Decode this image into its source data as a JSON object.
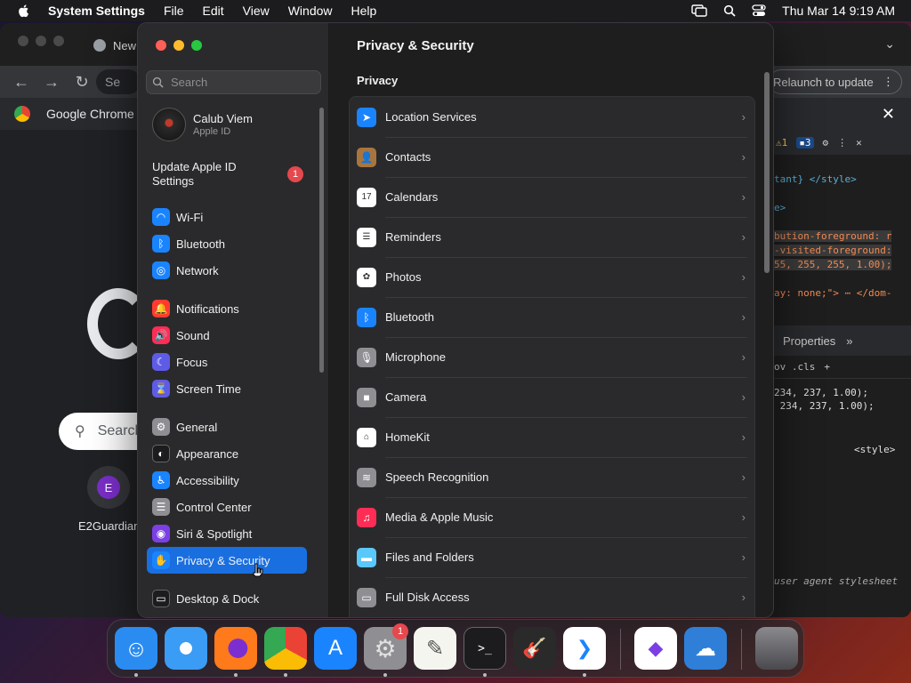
{
  "menubar": {
    "app": "System Settings",
    "items": [
      "File",
      "Edit",
      "View",
      "Window",
      "Help"
    ],
    "datetime": "Thu Mar 14  9:19 AM"
  },
  "chrome": {
    "tab_title": "New",
    "omnibox_text": "Se",
    "relaunch_label": "Relaunch to update",
    "infobar_text": "Google Chrome i",
    "search_placeholder": "Search",
    "shortcut_letter": "E",
    "shortcut_label": "E2Guardian"
  },
  "devtools": {
    "warn_count": "1",
    "info_count": "3",
    "code_lines": [
      "tant} </style>",
      "",
      "e>",
      "",
      "bution-foreground: r",
      "-visited-foreground:",
      "55, 255, 255, 1.00);",
      "",
      "ay: none;\"> ⋯ </dom-"
    ],
    "props_tab": "Properties",
    "styles_toolbar": "ov  .cls",
    "style_lines": [
      "234, 237, 1.00);",
      " 234, 237, 1.00);"
    ],
    "style_tag": "<style>",
    "ua_label": "user agent stylesheet"
  },
  "settings": {
    "search_placeholder": "Search",
    "user": {
      "name": "Calub Viem",
      "subtitle": "Apple ID"
    },
    "update": {
      "label": "Update Apple ID Settings",
      "badge": "1"
    },
    "sidebar": [
      {
        "label": "Wi-Fi",
        "icon": "wifi-icon",
        "color": "#1a84ff",
        "glyph": "◠"
      },
      {
        "label": "Bluetooth",
        "icon": "bluetooth-icon",
        "color": "#1a84ff",
        "glyph": "ᛒ"
      },
      {
        "label": "Network",
        "icon": "globe-icon",
        "color": "#1a84ff",
        "glyph": "◎"
      },
      {
        "label": "Notifications",
        "icon": "bell-icon",
        "color": "#ff3b30",
        "glyph": "🔔"
      },
      {
        "label": "Sound",
        "icon": "speaker-icon",
        "color": "#ff2d55",
        "glyph": "🔊"
      },
      {
        "label": "Focus",
        "icon": "moon-icon",
        "color": "#5e5ce6",
        "glyph": "☾"
      },
      {
        "label": "Screen Time",
        "icon": "hourglass-icon",
        "color": "#5e5ce6",
        "glyph": "⌛"
      },
      {
        "label": "General",
        "icon": "gear-icon",
        "color": "#8e8e93",
        "glyph": "⚙"
      },
      {
        "label": "Appearance",
        "icon": "appearance-icon",
        "color": "#1c1c1e",
        "glyph": "◐"
      },
      {
        "label": "Accessibility",
        "icon": "accessibility-icon",
        "color": "#1a84ff",
        "glyph": "♿"
      },
      {
        "label": "Control Center",
        "icon": "control-center-icon",
        "color": "#8e8e93",
        "glyph": "☰"
      },
      {
        "label": "Siri & Spotlight",
        "icon": "siri-icon",
        "color": "#7b3fe4",
        "glyph": "◉"
      },
      {
        "label": "Privacy & Security",
        "icon": "hand-icon",
        "color": "#1a84ff",
        "glyph": "✋",
        "active": true
      },
      {
        "label": "Desktop & Dock",
        "icon": "dock-icon",
        "color": "#1c1c1e",
        "glyph": "▭"
      }
    ],
    "main": {
      "title": "Privacy & Security",
      "section": "Privacy",
      "rows": [
        {
          "label": "Location Services",
          "icon": "location-arrow-icon",
          "color": "#1a84ff",
          "glyph": "➤"
        },
        {
          "label": "Contacts",
          "icon": "contacts-icon",
          "color": "#a8753f",
          "glyph": "👤"
        },
        {
          "label": "Calendars",
          "icon": "calendar-icon",
          "color": "#ffffff",
          "glyph": "17"
        },
        {
          "label": "Reminders",
          "icon": "reminders-icon",
          "color": "#ffffff",
          "glyph": "☰"
        },
        {
          "label": "Photos",
          "icon": "photos-icon",
          "color": "#ffffff",
          "glyph": "✿"
        },
        {
          "label": "Bluetooth",
          "icon": "bluetooth-icon",
          "color": "#1a84ff",
          "glyph": "ᛒ"
        },
        {
          "label": "Microphone",
          "icon": "microphone-icon",
          "color": "#8e8e93",
          "glyph": "🎙"
        },
        {
          "label": "Camera",
          "icon": "camera-icon",
          "color": "#8e8e93",
          "glyph": "■"
        },
        {
          "label": "HomeKit",
          "icon": "home-icon",
          "color": "#ffffff",
          "glyph": "⌂"
        },
        {
          "label": "Speech Recognition",
          "icon": "waveform-icon",
          "color": "#8e8e93",
          "glyph": "≋"
        },
        {
          "label": "Media & Apple Music",
          "icon": "music-note-icon",
          "color": "#ff2d55",
          "glyph": "♫"
        },
        {
          "label": "Files and Folders",
          "icon": "folder-icon",
          "color": "#5ac8fa",
          "glyph": "▬"
        },
        {
          "label": "Full Disk Access",
          "icon": "disk-icon",
          "color": "#8e8e93",
          "glyph": "▭"
        }
      ]
    }
  },
  "dock": {
    "settings_badge": "1",
    "apps": [
      {
        "name": "finder",
        "color": "#2a8cf0"
      },
      {
        "name": "safari",
        "color": "#e8f2ff"
      },
      {
        "name": "firefox",
        "color": "#ff7a1a"
      },
      {
        "name": "chrome",
        "color": "#ffffff"
      },
      {
        "name": "app-store",
        "color": "#1a84ff"
      },
      {
        "name": "system-settings",
        "color": "#8e8e93"
      },
      {
        "name": "textedit",
        "color": "#f5f5f0"
      },
      {
        "name": "terminal",
        "color": "#1c1c1e"
      },
      {
        "name": "garageband",
        "color": "#2a2a2a"
      },
      {
        "name": "vscode",
        "color": "#ffffff"
      },
      {
        "name": "visual-studio",
        "color": "#ffffff"
      },
      {
        "name": "weather",
        "color": "#2f7fd8"
      },
      {
        "name": "trash",
        "color": "#3a3a3c"
      }
    ]
  }
}
